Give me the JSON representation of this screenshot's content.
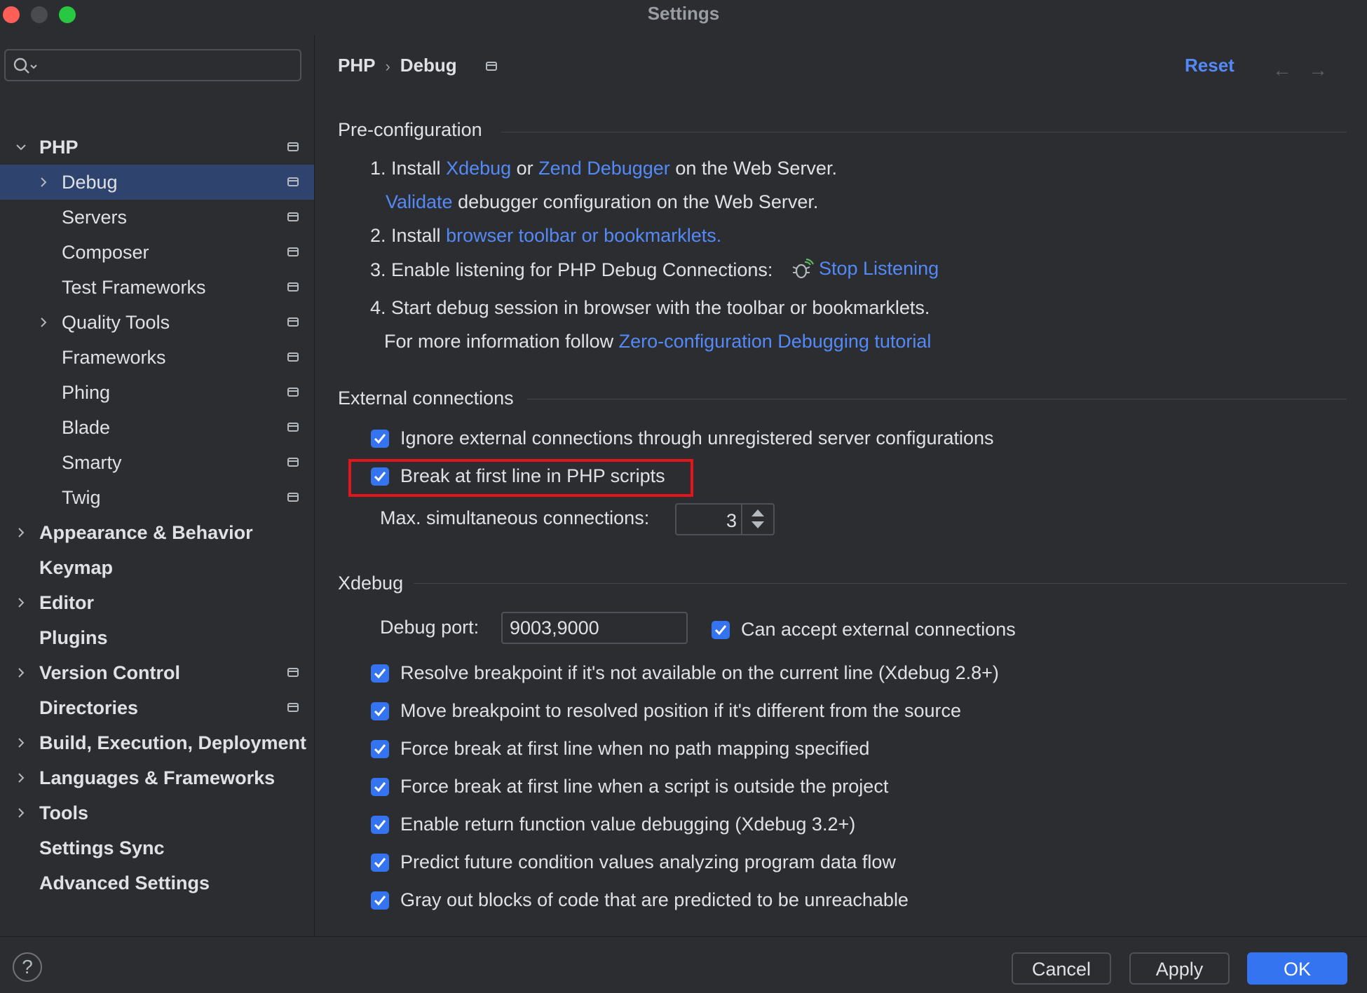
{
  "window": {
    "title": "Settings"
  },
  "sidebar": {
    "search_placeholder": "",
    "items": [
      {
        "label": "PHP",
        "chevron": "down",
        "bold": true,
        "project_icon": true
      },
      {
        "label": "Debug",
        "chevron": "right",
        "bold": false,
        "project_icon": true,
        "selected": true
      },
      {
        "label": "Servers",
        "chevron": "",
        "bold": false,
        "project_icon": true
      },
      {
        "label": "Composer",
        "chevron": "",
        "bold": false,
        "project_icon": true
      },
      {
        "label": "Test Frameworks",
        "chevron": "",
        "bold": false,
        "project_icon": true
      },
      {
        "label": "Quality Tools",
        "chevron": "right",
        "bold": false,
        "project_icon": true
      },
      {
        "label": "Frameworks",
        "chevron": "",
        "bold": false,
        "project_icon": true
      },
      {
        "label": "Phing",
        "chevron": "",
        "bold": false,
        "project_icon": true
      },
      {
        "label": "Blade",
        "chevron": "",
        "bold": false,
        "project_icon": true
      },
      {
        "label": "Smarty",
        "chevron": "",
        "bold": false,
        "project_icon": true
      },
      {
        "label": "Twig",
        "chevron": "",
        "bold": false,
        "project_icon": true
      },
      {
        "label": "Appearance & Behavior",
        "chevron": "right",
        "bold": true,
        "project_icon": false
      },
      {
        "label": "Keymap",
        "chevron": "",
        "bold": true,
        "project_icon": false
      },
      {
        "label": "Editor",
        "chevron": "right",
        "bold": true,
        "project_icon": false
      },
      {
        "label": "Plugins",
        "chevron": "",
        "bold": true,
        "project_icon": false
      },
      {
        "label": "Version Control",
        "chevron": "right",
        "bold": true,
        "project_icon": true
      },
      {
        "label": "Directories",
        "chevron": "",
        "bold": true,
        "project_icon": true
      },
      {
        "label": "Build, Execution, Deployment",
        "chevron": "right",
        "bold": true,
        "project_icon": false
      },
      {
        "label": "Languages & Frameworks",
        "chevron": "right",
        "bold": true,
        "project_icon": false
      },
      {
        "label": "Tools",
        "chevron": "right",
        "bold": true,
        "project_icon": false
      },
      {
        "label": "Settings Sync",
        "chevron": "",
        "bold": true,
        "project_icon": false
      },
      {
        "label": "Advanced Settings",
        "chevron": "",
        "bold": true,
        "project_icon": false
      }
    ]
  },
  "header": {
    "breadcrumb": [
      "PHP",
      "Debug"
    ],
    "breadcrumb_separator": "›",
    "reset_label": "Reset",
    "back_arrow": "←",
    "forward_arrow": "→"
  },
  "preconfig": {
    "title": "Pre-configuration",
    "step1_prefix": "1. Install ",
    "step1_link1": "Xdebug",
    "step1_or": " or ",
    "step1_link2": "Zend Debugger",
    "step1_suffix": " on the Web Server.",
    "validate_link": "Validate",
    "validate_suffix": " debugger configuration on the Web Server.",
    "step2_prefix": "2. Install ",
    "step2_link": "browser toolbar or bookmarklets.",
    "step3_text": "3. Enable listening for PHP Debug Connections:",
    "step3_link": "Stop Listening",
    "step4_text": "4. Start debug session in browser with the toolbar or bookmarklets.",
    "more_prefix": "For more information follow ",
    "more_link": "Zero-configuration Debugging tutorial"
  },
  "external": {
    "title": "External connections",
    "ignore_label": "Ignore external connections through unregistered server configurations",
    "ignore_checked": true,
    "break_label": "Break at first line in PHP scripts",
    "break_checked": true,
    "max_label": "Max. simultaneous connections:",
    "max_value": "3"
  },
  "xdebug": {
    "title": "Xdebug",
    "port_label": "Debug port:",
    "port_value": "9003,9000",
    "accept_label": "Can accept external connections",
    "options": [
      "Resolve breakpoint if it's not available on the current line (Xdebug 2.8+)",
      "Move breakpoint to resolved position if it's different from the source",
      "Force break at first line when no path mapping specified",
      "Force break at first line when a script is outside the project",
      "Enable return function value debugging (Xdebug 3.2+)",
      "Predict future condition values analyzing program data flow",
      "Gray out blocks of code that are predicted to be unreachable"
    ]
  },
  "footer": {
    "help": "?",
    "cancel_label": "Cancel",
    "apply_label": "Apply",
    "ok_label": "OK"
  },
  "colors": {
    "background": "#2b2d30",
    "accent": "#3574f0",
    "link": "#548af7",
    "selection": "#2e436e",
    "highlight_box": "#e3141b"
  }
}
